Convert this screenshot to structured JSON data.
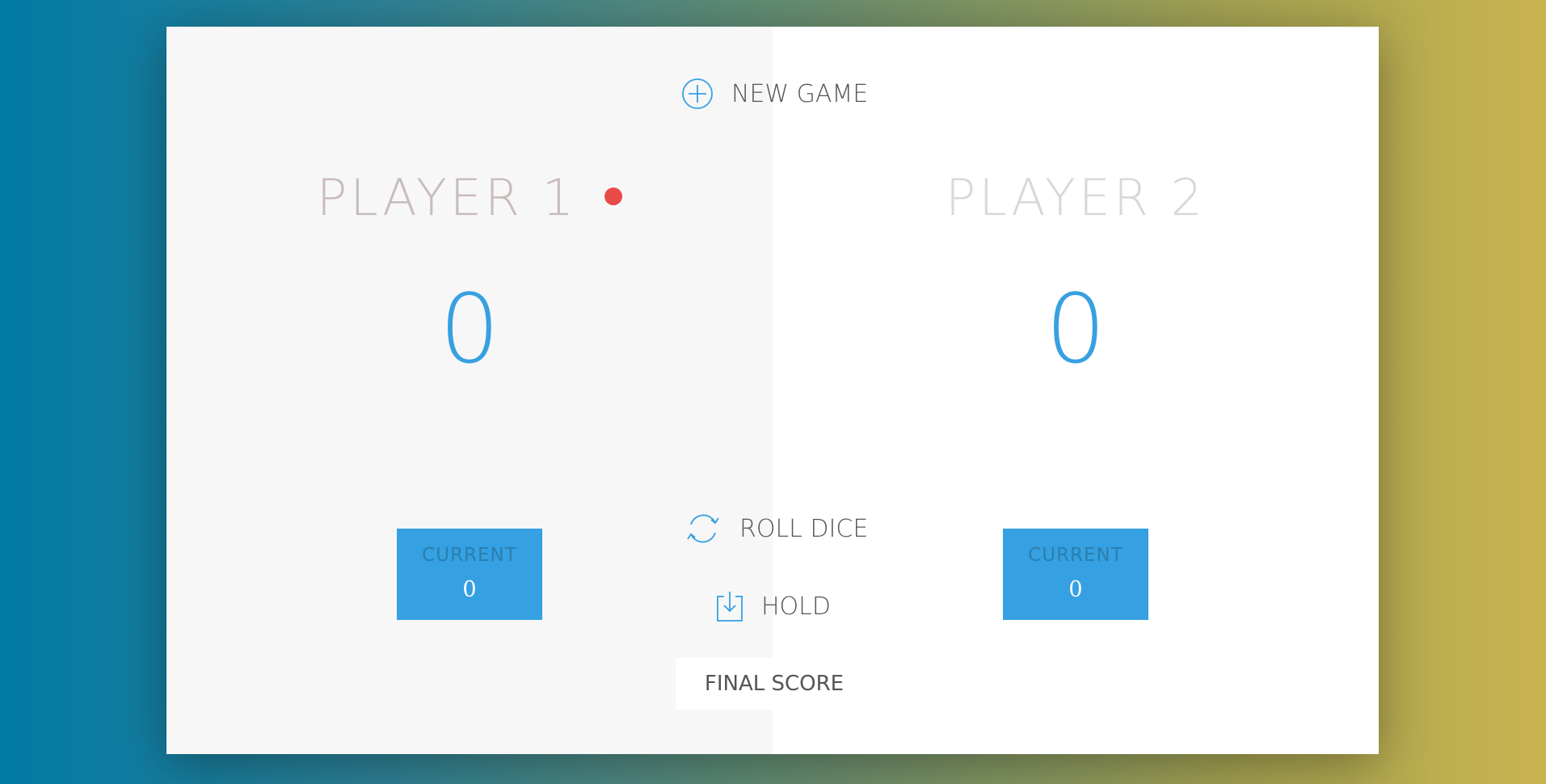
{
  "players": [
    {
      "name": "PLAYER 1",
      "score": "0",
      "current_label": "CURRENT",
      "current_value": "0",
      "active": true
    },
    {
      "name": "PLAYER 2",
      "score": "0",
      "current_label": "CURRENT",
      "current_value": "0",
      "active": false
    }
  ],
  "controls": {
    "new_game_label": "NEW GAME",
    "roll_dice_label": "ROLL DICE",
    "hold_label": "HOLD",
    "final_score_placeholder": "FINAL SCORE"
  },
  "icons": {
    "new_game": "plus-circle-icon",
    "roll_dice": "refresh-icon",
    "hold": "download-icon",
    "active_indicator": "red-dot-icon"
  },
  "colors": {
    "accent": "#35a0e2",
    "active_dot": "#e84a4a",
    "score": "#38a0e1",
    "left_panel": "#f7f7f7",
    "right_panel": "#ffffff"
  }
}
